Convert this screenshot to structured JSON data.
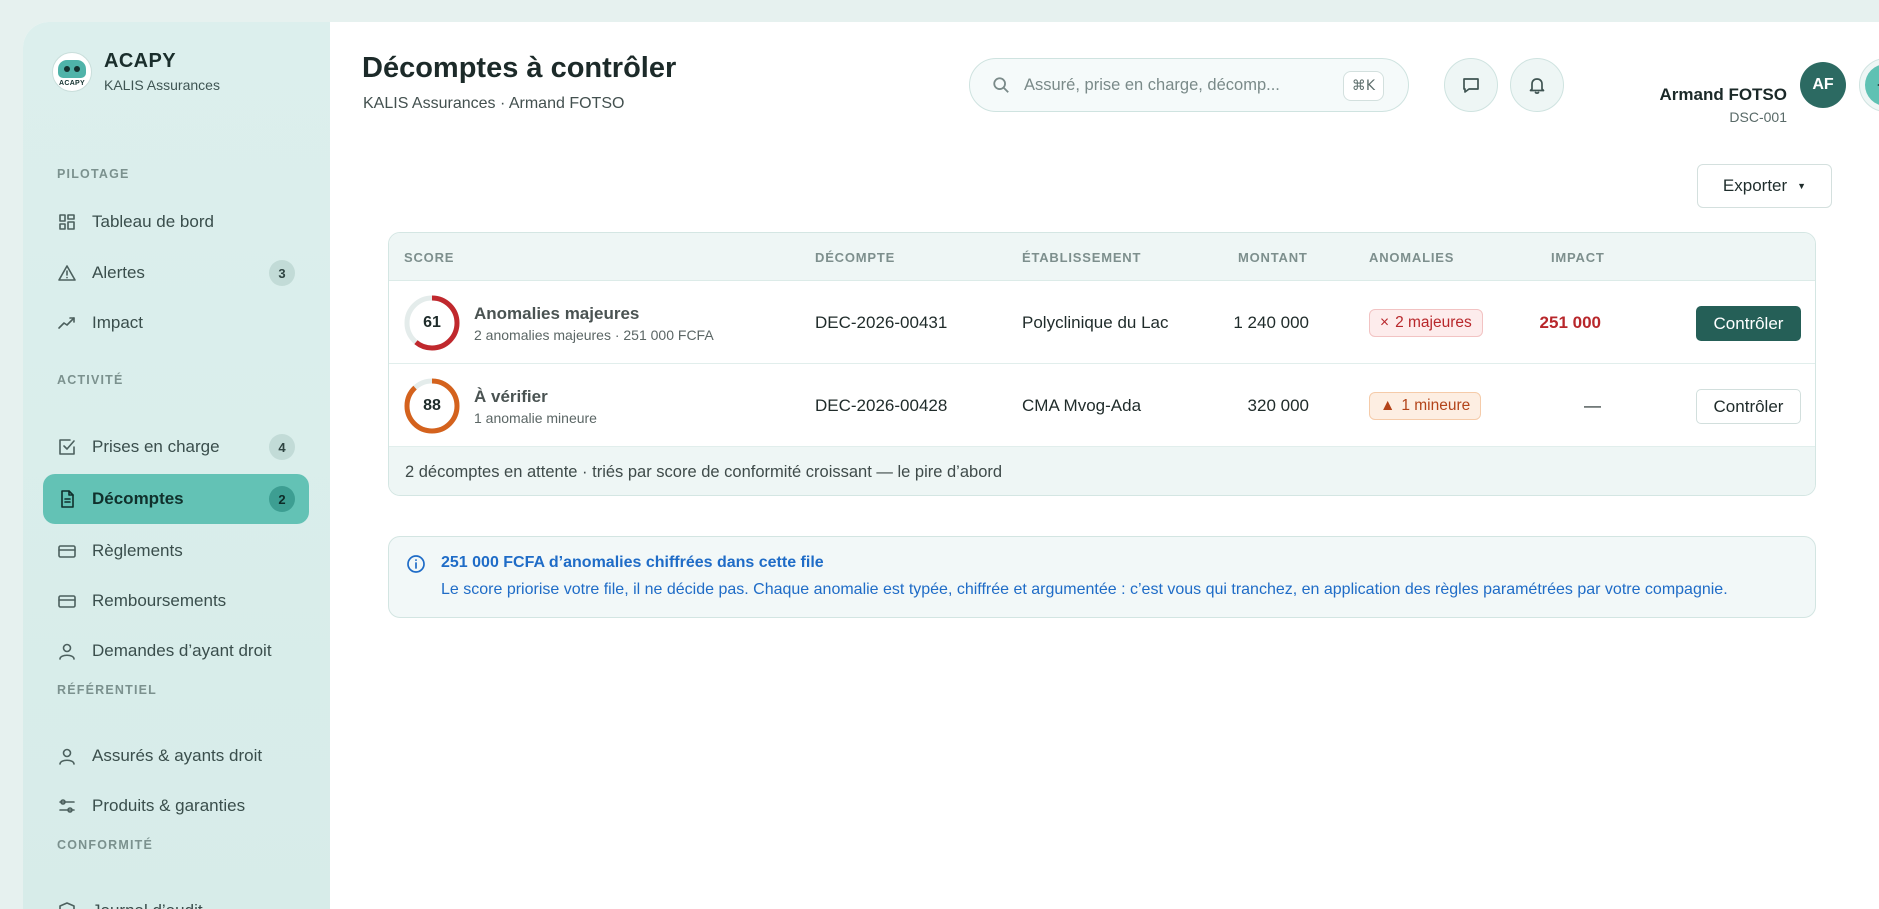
{
  "brand": {
    "name": "ACAPY",
    "logo_text": "ACAPY",
    "company": "KALIS Assurances"
  },
  "sidebar": {
    "sections": {
      "pilotage": "PILOTAGE",
      "activite": "ACTIVITÉ",
      "referentiel": "RÉFÉRENTIEL",
      "conformite": "CONFORMITÉ"
    },
    "items": [
      {
        "label": "Tableau de bord",
        "icon": "grid-icon"
      },
      {
        "label": "Alertes",
        "icon": "alert-triangle-icon",
        "count": "3"
      },
      {
        "label": "Impact",
        "icon": "trend-icon"
      },
      {
        "label": "Prises en charge",
        "icon": "check-square-icon",
        "count": "4"
      },
      {
        "label": "Décomptes",
        "icon": "document-icon",
        "count": "2",
        "active": true
      },
      {
        "label": "Règlements",
        "icon": "card-icon"
      },
      {
        "label": "Remboursements",
        "icon": "card-icon"
      },
      {
        "label": "Demandes d’ayant droit",
        "icon": "user-icon"
      },
      {
        "label": "Assurés & ayants droit",
        "icon": "user-icon"
      },
      {
        "label": "Produits & garanties",
        "icon": "sliders-icon"
      },
      {
        "label": "Journal d’audit",
        "icon": "shield-icon"
      }
    ]
  },
  "header": {
    "title": "Décomptes à contrôler",
    "subtitle": "KALIS Assurances · Armand FOTSO",
    "search_placeholder": "Assuré, prise en charge, décomp...",
    "shortcut": "⌘K"
  },
  "user": {
    "name": "Armand FOTSO",
    "id": "DSC-001",
    "initials": "AF"
  },
  "toolbar": {
    "export_label": "Exporter",
    "export_caret": "▼"
  },
  "table": {
    "headers": [
      "SCORE",
      "DÉCOMPTE",
      "ÉTABLISSEMENT",
      "MONTANT",
      "ANOMALIES",
      "IMPACT"
    ],
    "rows": [
      {
        "score": 61,
        "score_fraction": 0.61,
        "ring_color": "#c0282d",
        "title": "Anomalies majeures",
        "subtitle": "2 anomalies majeures · 251 000 FCFA",
        "decompte": "DEC-2026-00431",
        "etablissement": "Polyclinique du Lac",
        "montant": "1 240 000",
        "anomaly_icon": "×",
        "anomaly_label": "2 majeures",
        "impact": "251 000",
        "action": "Contrôler"
      },
      {
        "score": 88,
        "score_fraction": 0.88,
        "ring_color": "#d4621d",
        "title": "À vérifier",
        "subtitle": "1 anomalie mineure",
        "decompte": "DEC-2026-00428",
        "etablissement": "CMA Mvog-Ada",
        "montant": "320 000",
        "anomaly_icon": "▲",
        "anomaly_label": "1 mineure",
        "impact": "—",
        "action": "Contrôler"
      }
    ],
    "footer": "2 décomptes en attente · triés par score de conformité croissant — le pire d’abord"
  },
  "info": {
    "title": "251 000 FCFA d’anomalies chiffrées dans cette file",
    "body": "Le score priorise votre file, il ne décide pas. Chaque anomalie est typée, chiffrée et argumentée : c’est vous qui tranchez, en application des règles paramétrées par votre compagnie."
  },
  "colors": {
    "accent": "#63c2b5",
    "primary_button": "#255f57",
    "danger": "#b8272b",
    "info": "#1f6cc7"
  }
}
